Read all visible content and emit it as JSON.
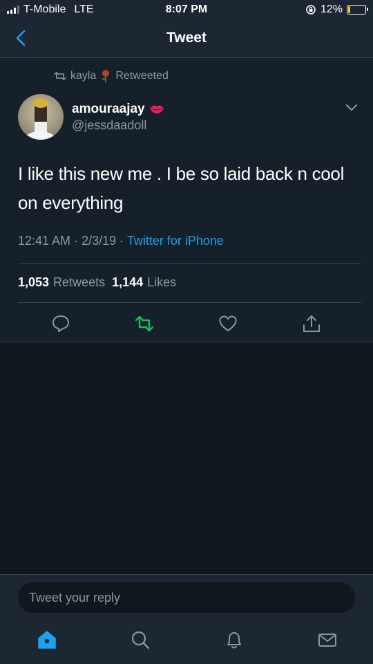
{
  "status_bar": {
    "carrier": "T-Mobile",
    "network": "LTE",
    "time": "8:07 PM",
    "battery": "12%",
    "battery_level": 0.12,
    "battery_color": "#f5c518"
  },
  "header": {
    "title": "Tweet",
    "back_icon": "chevron-left-icon"
  },
  "tweet": {
    "retweeted_by": "kayla",
    "retweeted_label": "Retweeted",
    "author_name": "amouraajay",
    "author_handle": "@jessdaadoll",
    "text": "I like this new me . I be so laid back n cool on everything",
    "time": "12:41 AM",
    "date": "2/3/19",
    "source": "Twitter for iPhone",
    "retweets_count": "1,053",
    "retweets_label": "Retweets",
    "likes_count": "1,144",
    "likes_label": "Likes"
  },
  "colors": {
    "background": "#15202b",
    "accent": "#1da1f2",
    "retweet_green": "#17bf63",
    "muted": "#8899a6",
    "rose": "#c0392b",
    "lips": "#e0245e"
  },
  "reply": {
    "placeholder": "Tweet your reply"
  },
  "tabs": [
    "home-icon",
    "search-icon",
    "notifications-icon",
    "messages-icon"
  ]
}
